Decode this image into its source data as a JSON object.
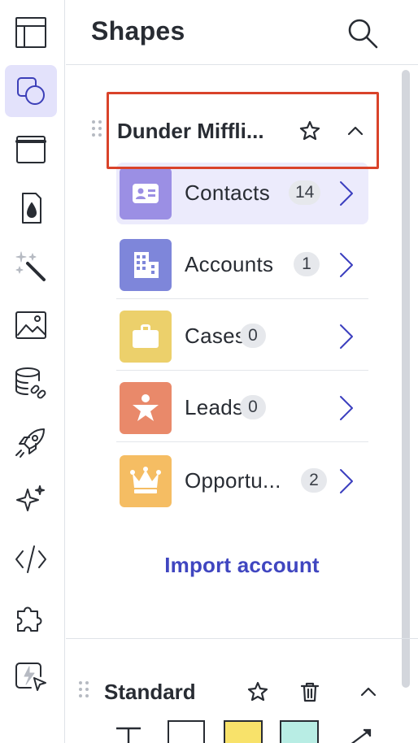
{
  "rail": {
    "items": [
      {
        "name": "layout-panel",
        "icon": "layout-icon",
        "active": false
      },
      {
        "name": "shapes",
        "icon": "shapes-icon",
        "active": true
      },
      {
        "name": "frame",
        "icon": "frame-icon",
        "active": false
      },
      {
        "name": "fill",
        "icon": "fill-drop-icon",
        "active": false
      },
      {
        "name": "magic",
        "icon": "magic-wand-icon",
        "active": false
      },
      {
        "name": "image",
        "icon": "image-icon",
        "active": false
      },
      {
        "name": "data-link",
        "icon": "database-link-icon",
        "active": false
      },
      {
        "name": "launch",
        "icon": "rocket-icon",
        "active": false
      },
      {
        "name": "ai",
        "icon": "sparkle-icon",
        "active": false
      },
      {
        "name": "embed",
        "icon": "code-icon",
        "active": false
      },
      {
        "name": "integrations",
        "icon": "puzzle-icon",
        "active": false
      },
      {
        "name": "quick-action",
        "icon": "lightning-cursor-icon",
        "active": false
      }
    ]
  },
  "panel": {
    "title": "Shapes",
    "search_icon": "search-icon"
  },
  "group": {
    "title": "Dunder Miffli...",
    "favorite_icon": "star-icon",
    "collapse_icon": "chevron-up-icon",
    "items": [
      {
        "label": "Contacts",
        "count": "14",
        "icon": "contact-card-icon",
        "color": "#9b8fe4"
      },
      {
        "label": "Accounts",
        "count": "1",
        "icon": "building-icon",
        "color": "#7e86da"
      },
      {
        "label": "Cases",
        "count": "0",
        "icon": "briefcase-icon",
        "color": "#ecd06b"
      },
      {
        "label": "Leads",
        "count": "0",
        "icon": "person-star-icon",
        "color": "#e9896a"
      },
      {
        "label": "Opportu...",
        "count": "2",
        "icon": "crown-icon",
        "color": "#f5bd63"
      }
    ],
    "import_label": "Import account"
  },
  "standard": {
    "title": "Standard",
    "favorite_icon": "star-icon",
    "delete_icon": "trash-icon",
    "collapse_icon": "chevron-up-icon"
  },
  "colors": {
    "accent": "#4046c0",
    "highlight": "#d9432a",
    "rail_active": "#e3e2fb"
  }
}
